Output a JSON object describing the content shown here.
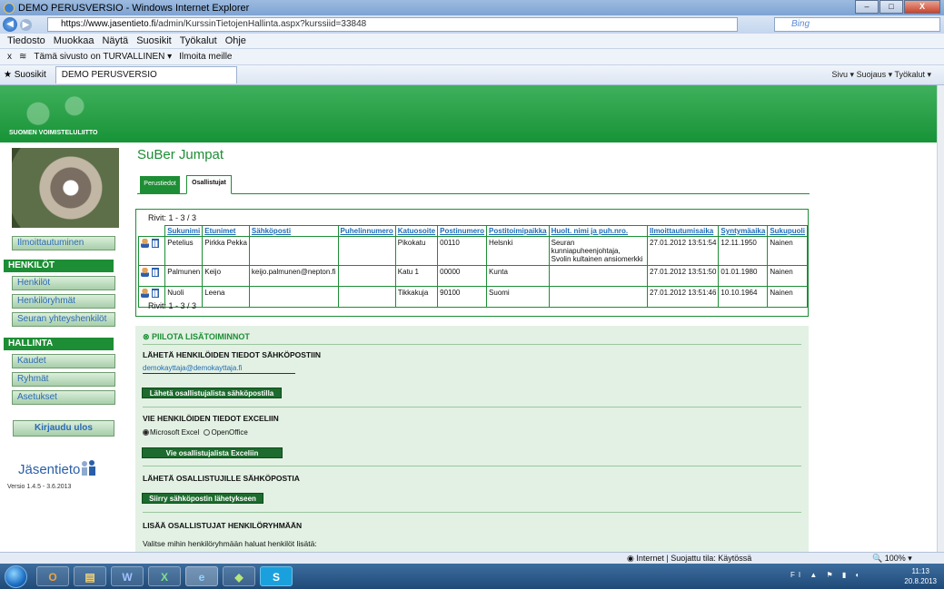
{
  "window": {
    "title": "DEMO PERUSVERSIO - Windows Internet Explorer",
    "minimize": "–",
    "maximize": "□",
    "close": "X"
  },
  "address": {
    "url_host": "https://www.jasentieto.fi",
    "url_path": "/admin/KurssinTietojenHallinta.aspx?kurssiid=33848",
    "search_placeholder": "Bing"
  },
  "menu": [
    "Tiedosto",
    "Muokkaa",
    "Näytä",
    "Suosikit",
    "Työkalut",
    "Ohje"
  ],
  "toolbar2": {
    "safe": "Tämä sivusto on TURVALLINEN ▾",
    "report": "Ilmoita meille"
  },
  "favbar": {
    "favorites": "Suosikit",
    "tab": "DEMO PERUSVERSIO",
    "tools": "Sivu ▾   Suojaus ▾   Työkalut ▾"
  },
  "banner": {
    "org": "SUOMEN VOIMISTELULIITTO"
  },
  "sidebar": {
    "ilmoittautuminen": "Ilmoittautuminen",
    "henkilot_head": "HENKILÖT",
    "henkilot": "Henkilöt",
    "henkiloryhmat": "Henkilöryhmät",
    "seuran": "Seuran yhteyshenkilöt",
    "hallinta_head": "HALLINTA",
    "kaudet": "Kaudet",
    "ryhmat": "Ryhmät",
    "asetukset": "Asetukset",
    "logout": "Kirjaudu ulos",
    "logo": "Jäsentieto",
    "version": "Versio 1.4.5 - 3.6.2013"
  },
  "page": {
    "title": "SuBer Jumpat",
    "tab_basic": "Perustiedot",
    "tab_participants": "Osallistujat"
  },
  "table": {
    "rows_info": "Rivit: 1 - 3  /  3",
    "headers": [
      "Sukunimi",
      "Etunimet",
      "Sähköposti",
      "Puhelinnumero",
      "Katuosoite",
      "Postinumero",
      "Postitoimipaikka",
      "Huolt. nimi ja puh.nro.",
      "Ilmoittautumisaika",
      "Syntymäaika",
      "Sukupuoli"
    ],
    "rows": [
      [
        "Petelius",
        "Pirkka Pekka",
        "",
        "",
        "Pikokatu",
        "00110",
        "Helsnki",
        "Seuran kunniapuheenjohtaja,\nSvolin kultainen ansiomerkki",
        "27.01.2012 13:51:54",
        "12.11.1950",
        "Nainen"
      ],
      [
        "Palmunen",
        "Keijo",
        "keijo.palmunen@nepton.fi",
        "",
        "Katu 1",
        "00000",
        "Kunta",
        "",
        "27.01.2012 13:51:50",
        "01.01.1980",
        "Nainen"
      ],
      [
        "Nuoli",
        "Leena",
        "",
        "",
        "Tikkakuja",
        "90100",
        "Suomi",
        "",
        "27.01.2012 13:51:46",
        "10.10.1964",
        "Nainen"
      ]
    ]
  },
  "panel": {
    "toggle": "PIILOTA LISÄTOIMINNOT",
    "email_head": "LÄHETÄ HENKILÖIDEN TIEDOT SÄHKÖPOSTIIN",
    "email_value": "demokayttaja@demokayttaja.fi",
    "email_btn": "Lähetä osallistujalista sähköpostilla",
    "excel_head": "VIE HENKILÖIDEN TIEDOT EXCELIIN",
    "opt_excel": "Microsoft Excel",
    "opt_office": "OpenOffice",
    "excel_btn": "Vie osallistujalista Exceliin",
    "mail_head": "LÄHETÄ OSALLISTUJILLE SÄHKÖPOSTIA",
    "mail_btn": "Siirry sähköpostin lähetykseen",
    "group_head": "LISÄÄ OSALLISTUJAT HENKILÖRYHMÄÄN",
    "group_text": "Valitse mihin henkilöryhmään haluat henkilöt lisätä:"
  },
  "status": {
    "net": "Internet | Suojattu tila: Käytössä",
    "zoom": "100%"
  },
  "taskbar": {
    "time": "11:13",
    "date": "20.8.2013"
  }
}
